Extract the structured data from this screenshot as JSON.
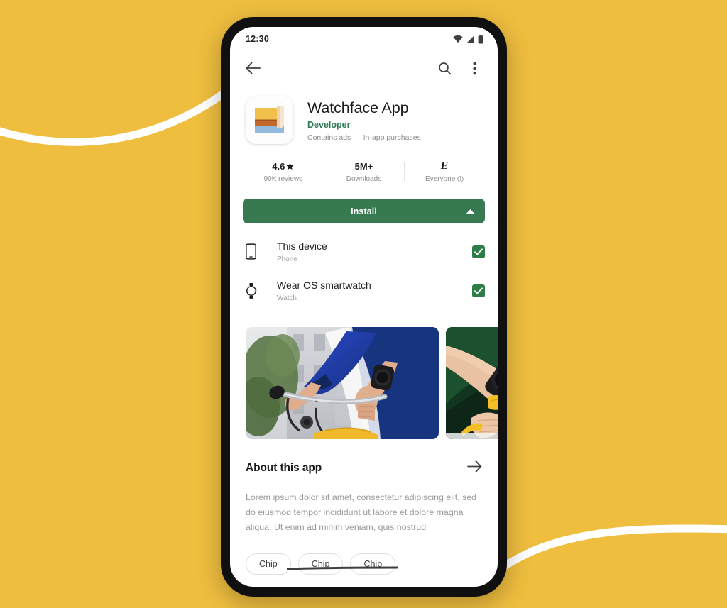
{
  "theme": {
    "backdrop_color": "#EFBE3F",
    "ribbon_color": "#FFFFFF",
    "phone_frame_color": "#101010",
    "screen_color": "#FFFFFF",
    "install_green": "#377A52",
    "checkbox_green": "#2E7D48",
    "developer_green": "#2E7D56",
    "primary_text": "#1B1B1B",
    "secondary_text": "#8D8D8D"
  },
  "status_bar": {
    "time": "12:30",
    "icons": [
      "wifi-icon",
      "cellular-signal-icon",
      "battery-icon"
    ]
  },
  "app_bar": {
    "back_icon": "arrow-back-icon",
    "search_icon": "search-icon",
    "overflow_icon": "more-vert-icon"
  },
  "app_header": {
    "icon_name": "watchface-app-icon",
    "title": "Watchface App",
    "developer": "Developer",
    "badges": [
      "Contains ads",
      "In-app purchases"
    ],
    "badge_separator": "·"
  },
  "stats": [
    {
      "name": "rating",
      "primary": "4.6",
      "primary_icon": "star-icon",
      "caption": "90K reviews",
      "caption_icon": null
    },
    {
      "name": "downloads",
      "primary": "5M+",
      "primary_icon": null,
      "caption": "Downloads",
      "caption_icon": null
    },
    {
      "name": "content-rating",
      "primary": "E",
      "primary_icon": "esrb-everyone-icon",
      "caption": "Everyone",
      "caption_icon": "info-outline-icon"
    }
  ],
  "install": {
    "label": "Install",
    "expand_icon": "caret-up-icon"
  },
  "devices": [
    {
      "icon": "phone-icon",
      "name": "This device",
      "kind": "Phone",
      "checked": true,
      "check_icon": "checkmark-icon"
    },
    {
      "icon": "watch-icon",
      "name": "Wear OS smartwatch",
      "kind": "Watch",
      "checked": true,
      "check_icon": "checkmark-icon"
    }
  ],
  "screenshots": [
    {
      "alt": "cyclist-wearing-smartwatch-on-handlebars"
    },
    {
      "alt": "wrist-with-smartwatch-close-up"
    }
  ],
  "about": {
    "title": "About this app",
    "arrow_icon": "arrow-forward-icon",
    "description": "Lorem ipsum dolor sit amet, consectetur adipiscing elit, sed do eiusmod tempor incididunt ut labore et dolore magna aliqua. Ut enim ad minim veniam, quis nostrud"
  },
  "chips": [
    {
      "label": "Chip"
    },
    {
      "label": "Chip"
    },
    {
      "label": "Chip"
    }
  ]
}
